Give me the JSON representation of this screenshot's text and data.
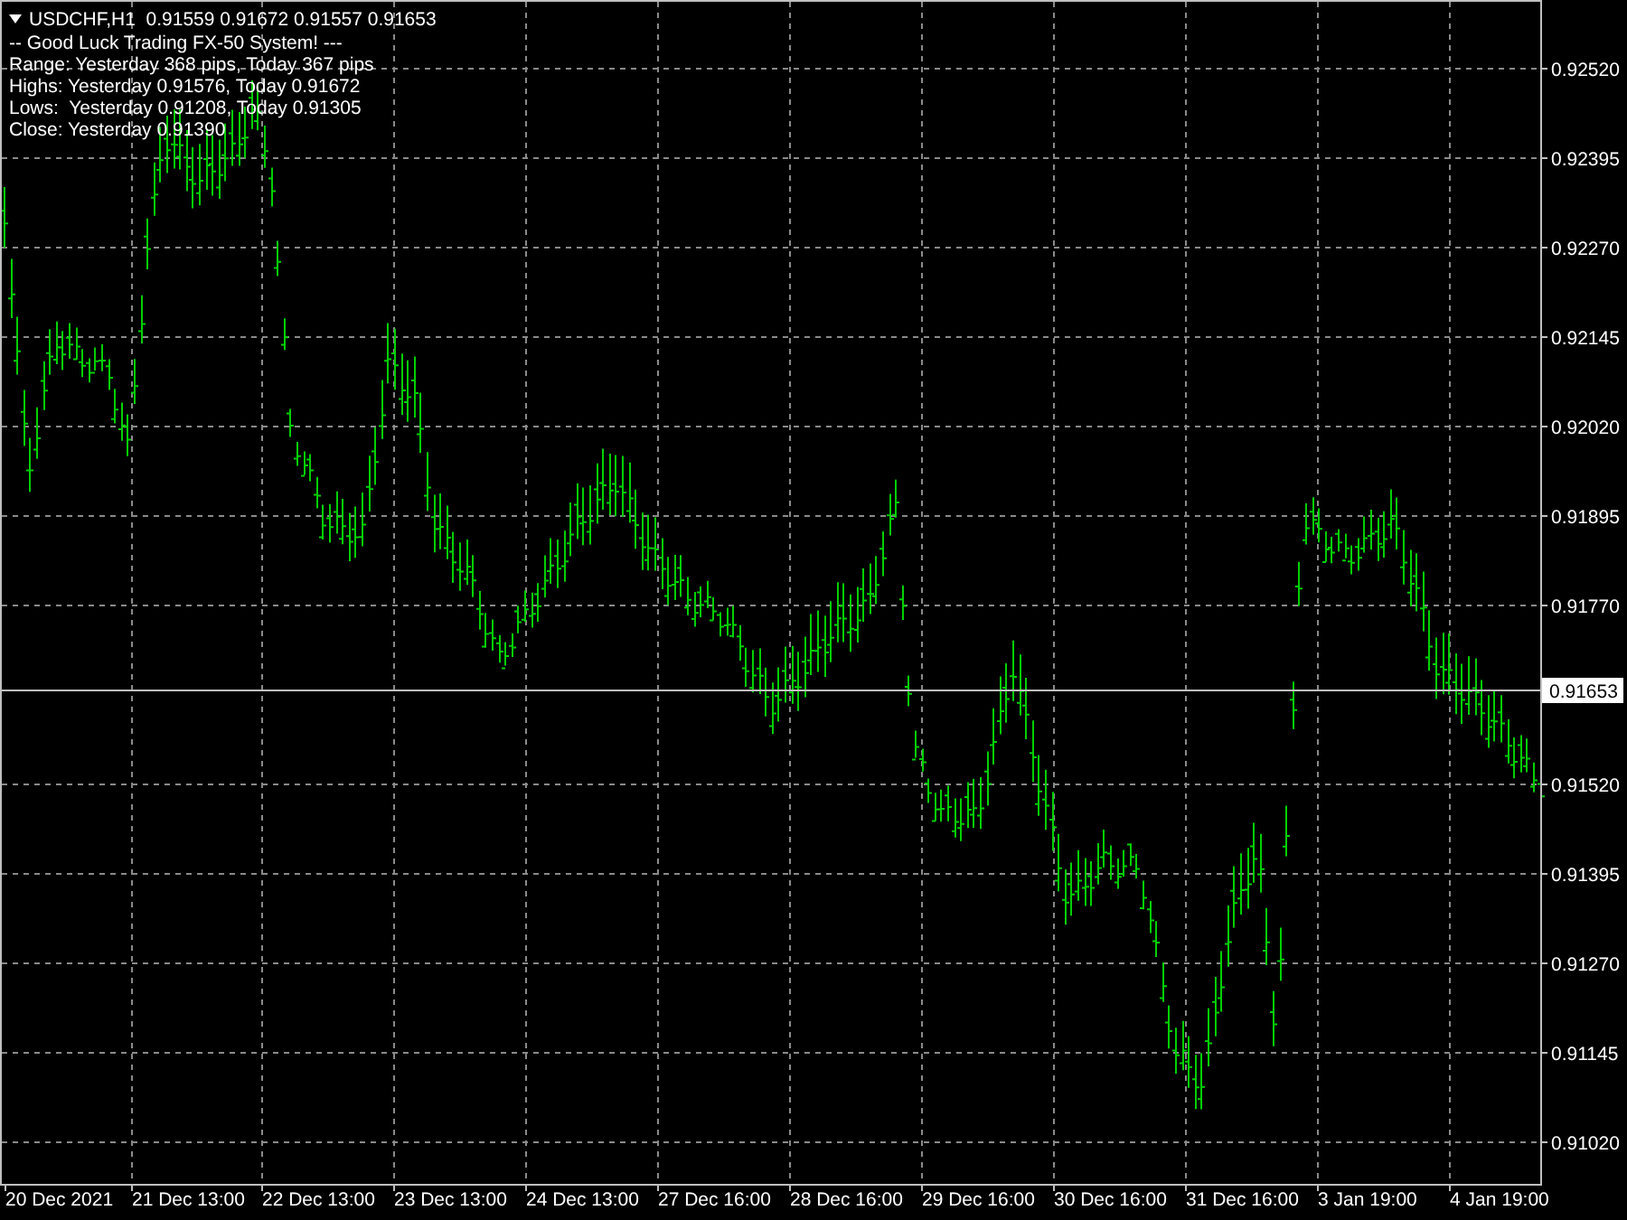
{
  "chart_header": {
    "symbol": "USDCHF,H1",
    "quotes": [
      "0.91559",
      "0.91672",
      "0.91557",
      "0.91653"
    ]
  },
  "info_lines": [
    "-- Good Luck Trading FX-50 System! ---",
    "Range: Yesterday 368 pips, Today 367 pips",
    "Highs: Yesterday 0.91576, Today 0.91672",
    "Lows:  Yesterday 0.91208, Today 0.91305",
    "Close: Yesterday 0.91390"
  ],
  "price_axis": [
    {
      "label": "0.92520",
      "current": false
    },
    {
      "label": "0.92395",
      "current": false
    },
    {
      "label": "0.92270",
      "current": false
    },
    {
      "label": "0.92145",
      "current": false
    },
    {
      "label": "0.92020",
      "current": false
    },
    {
      "label": "0.91895",
      "current": false
    },
    {
      "label": "0.91770",
      "current": false
    },
    {
      "label": "0.91653",
      "current": true
    },
    {
      "label": "0.91520",
      "current": false
    },
    {
      "label": "0.91395",
      "current": false
    },
    {
      "label": "0.91270",
      "current": false
    },
    {
      "label": "0.91145",
      "current": false
    },
    {
      "label": "0.91020",
      "current": false
    }
  ],
  "time_axis": [
    "20 Dec 2021",
    "21 Dec 13:00",
    "22 Dec 13:00",
    "23 Dec 13:00",
    "24 Dec 13:00",
    "27 Dec 16:00",
    "28 Dec 16:00",
    "29 Dec 16:00",
    "30 Dec 16:00",
    "31 Dec 16:00",
    "3 Jan 19:00",
    "4 Jan 19:00"
  ]
}
